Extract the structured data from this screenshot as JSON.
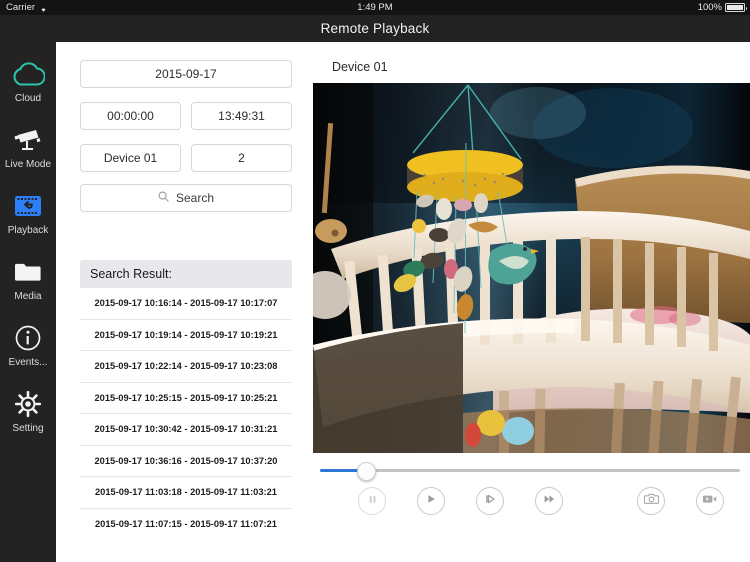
{
  "status_bar": {
    "carrier": "Carrier",
    "wifi_icon": "wifi-icon",
    "time": "1:49 PM",
    "battery_percent": "100%",
    "battery_icon": "battery-full-icon"
  },
  "navbar": {
    "title": "Remote Playback"
  },
  "sidebar": {
    "items": [
      {
        "label": "Cloud",
        "icon": "cloud-icon",
        "active": false,
        "color": "#2ec4a8"
      },
      {
        "label": "Live Mode",
        "icon": "cctv-camera-icon",
        "active": false,
        "color": "#f2f2f2"
      },
      {
        "label": "Playback",
        "icon": "playback-film-icon",
        "active": true,
        "color": "#2d7ff9"
      },
      {
        "label": "Media",
        "icon": "folder-icon",
        "active": false,
        "color": "#f2f2f2"
      },
      {
        "label": "Events...",
        "icon": "info-circle-icon",
        "active": false,
        "color": "#f2f2f2"
      },
      {
        "label": "Setting",
        "icon": "gear-icon",
        "active": false,
        "color": "#f2f2f2"
      }
    ]
  },
  "search_form": {
    "date": "2015-09-17",
    "start_time": "00:00:00",
    "end_time": "13:49:31",
    "device": "Device 01",
    "channel": "2",
    "search_button": "Search",
    "search_icon": "search-icon"
  },
  "search_result": {
    "header": "Search Result:",
    "rows": [
      "2015-09-17 10:16:14 - 2015-09-17 10:17:07",
      "2015-09-17 10:19:14 - 2015-09-17 10:19:21",
      "2015-09-17 10:22:14 - 2015-09-17 10:23:08",
      "2015-09-17 10:25:15 - 2015-09-17 10:25:21",
      "2015-09-17 10:30:42 - 2015-09-17 10:31:21",
      "2015-09-17 10:36:16 - 2015-09-17 10:37:20",
      "2015-09-17 11:03:18 - 2015-09-17 11:03:21",
      "2015-09-17 11:07:15 - 2015-09-17 11:07:21"
    ]
  },
  "player": {
    "device_title": "Device 01",
    "video_description": "Baby crib with hanging mobile of fabric birds",
    "progress_percent": 11,
    "controls": [
      {
        "name": "pause-button",
        "icon": "pause-icon",
        "state": "disabled"
      },
      {
        "name": "play-button",
        "icon": "play-icon",
        "state": "enabled"
      },
      {
        "name": "step-forward-button",
        "icon": "step-forward-icon",
        "state": "enabled"
      },
      {
        "name": "fast-forward-button",
        "icon": "fast-forward-icon",
        "state": "enabled"
      },
      {
        "name": "snapshot-button",
        "icon": "camera-icon",
        "state": "enabled"
      },
      {
        "name": "record-button",
        "icon": "video-camera-icon",
        "state": "enabled"
      }
    ],
    "accent_color": "#2f78d8"
  }
}
